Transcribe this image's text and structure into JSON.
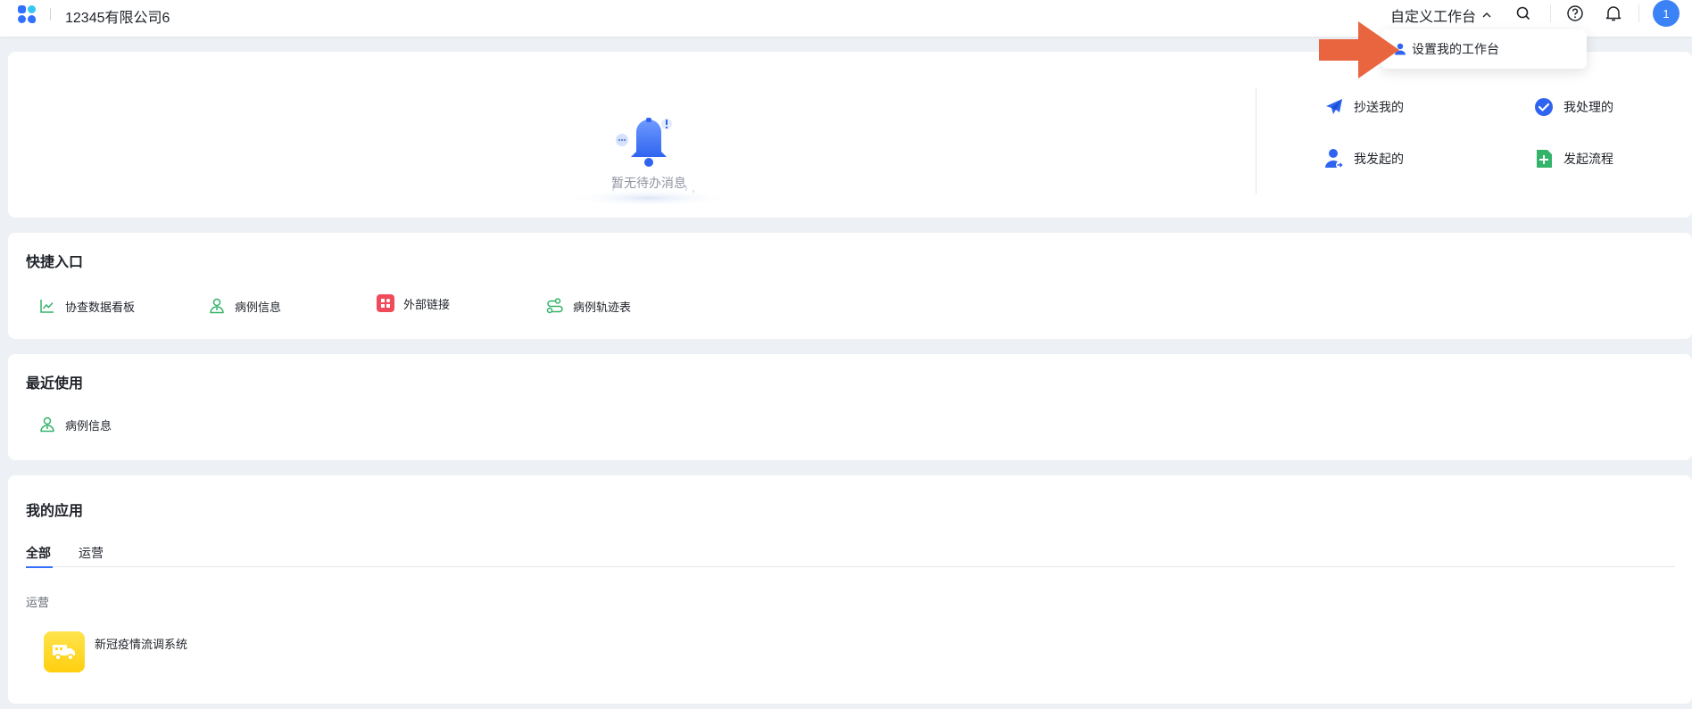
{
  "header": {
    "company": "12345有限公司6",
    "workspace_switch": "自定义工作台",
    "avatar_text": "1"
  },
  "dropdown": {
    "item": "设置我的工作台"
  },
  "notifications": {
    "empty_text": "暂无待办消息",
    "actions": [
      {
        "label": "抄送我的",
        "icon": "paper-plane-icon"
      },
      {
        "label": "我处理的",
        "icon": "check-circle-icon"
      },
      {
        "label": "我发起的",
        "icon": "user-send-icon"
      },
      {
        "label": "发起流程",
        "icon": "plus-square-icon"
      }
    ]
  },
  "quick_entry": {
    "title": "快捷入口",
    "items": [
      {
        "label": "协查数据看板",
        "icon": "line-chart-icon"
      },
      {
        "label": "病例信息",
        "icon": "person-info-icon"
      },
      {
        "label": "外部链接",
        "icon": "app-grid-icon"
      },
      {
        "label": "病例轨迹表",
        "icon": "route-icon"
      }
    ]
  },
  "recent": {
    "title": "最近使用",
    "items": [
      {
        "label": "病例信息",
        "icon": "person-info-icon"
      }
    ]
  },
  "my_apps": {
    "title": "我的应用",
    "tabs": [
      {
        "label": "全部",
        "active": true
      },
      {
        "label": "运营",
        "active": false
      }
    ],
    "group_label": "运营",
    "apps": [
      {
        "name": "新冠疫情流调系统",
        "icon": "truck-icon",
        "color": "#ffd81f"
      }
    ]
  },
  "colors": {
    "accent": "#3370ff",
    "green_icon": "#34c759",
    "pointer_arrow": "#e8653f"
  }
}
